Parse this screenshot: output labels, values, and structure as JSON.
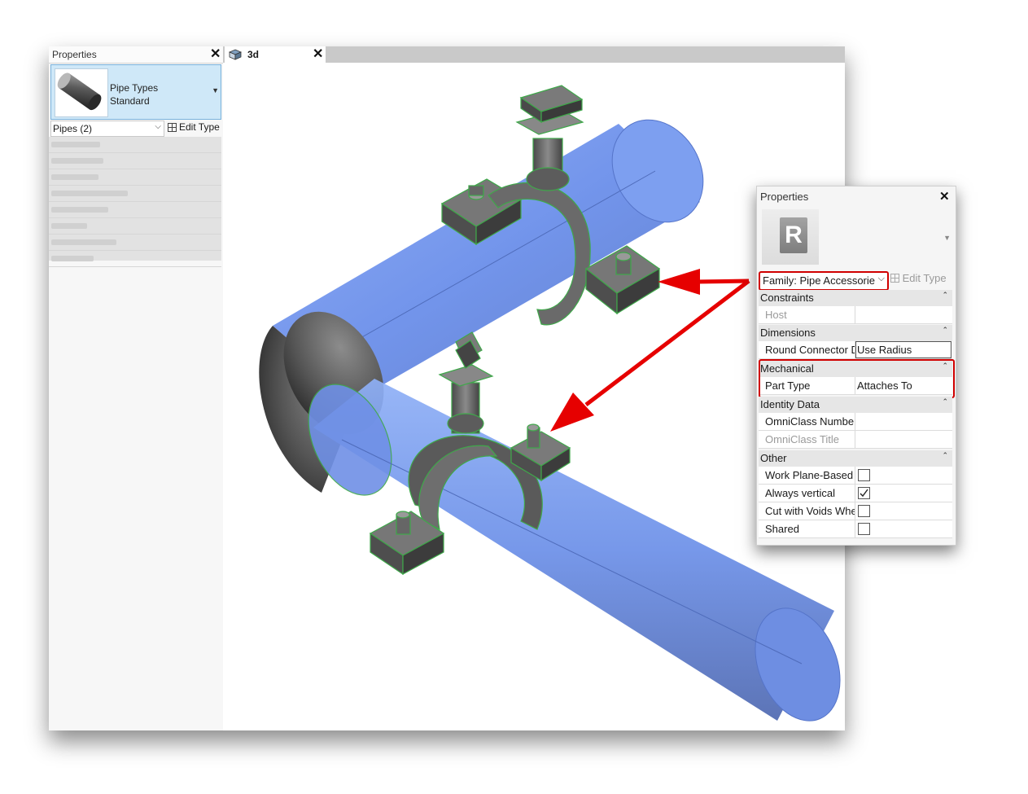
{
  "left_panel": {
    "title": "Properties",
    "type_name_line1": "Pipe Types",
    "type_name_line2": "Standard",
    "selector": "Pipes (2)",
    "edit_type": "Edit Type"
  },
  "tab": {
    "label": "3d"
  },
  "right_panel": {
    "title": "Properties",
    "logo_letter": "R",
    "family": "Family: Pipe Accessories",
    "edit_type": "Edit Type",
    "groups": {
      "constraints": "Constraints",
      "dimensions": "Dimensions",
      "mechanical": "Mechanical",
      "identity": "Identity Data",
      "other": "Other"
    },
    "rows": {
      "host": {
        "label": "Host"
      },
      "round_connector": {
        "label": "Round Connector Dimension",
        "value": "Use Radius"
      },
      "part_type": {
        "label": "Part Type",
        "value": "Attaches To"
      },
      "omniclass_num": {
        "label": "OmniClass Number"
      },
      "omniclass_title": {
        "label": "OmniClass Title"
      },
      "work_plane": {
        "label": "Work Plane-Based",
        "checked": false
      },
      "always_vertical": {
        "label": "Always vertical",
        "checked": true
      },
      "cut_voids": {
        "label": "Cut with Voids When Loaded",
        "checked": false
      },
      "shared": {
        "label": "Shared",
        "checked": false
      }
    }
  },
  "colors": {
    "pipe": "#6b93ee",
    "hanger": "#6f6f6f",
    "outline": "#3fa84a",
    "highlight": "#d00000",
    "selection": "#cfe8f8"
  }
}
